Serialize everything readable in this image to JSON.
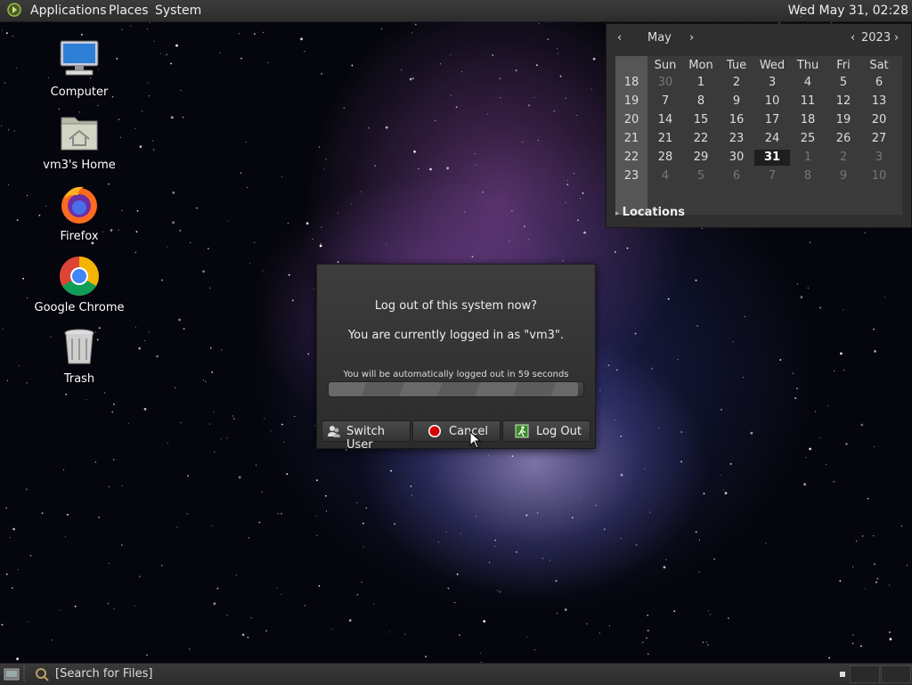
{
  "top_panel": {
    "menus": [
      "Applications",
      "Places",
      "System"
    ],
    "clock": "Wed May 31, 02:28"
  },
  "desktop_icons": [
    {
      "label": "Computer",
      "icon": "computer-icon"
    },
    {
      "label": "vm3's Home",
      "icon": "home-folder-icon"
    },
    {
      "label": "Firefox",
      "icon": "firefox-icon"
    },
    {
      "label": "Google Chrome",
      "icon": "chrome-icon"
    },
    {
      "label": "Trash",
      "icon": "trash-icon"
    }
  ],
  "calendar": {
    "month": "May",
    "year": "2023",
    "day_names": [
      "Sun",
      "Mon",
      "Tue",
      "Wed",
      "Thu",
      "Fri",
      "Sat"
    ],
    "weeks": [
      {
        "week": "18",
        "days": [
          "30",
          "1",
          "2",
          "3",
          "4",
          "5",
          "6"
        ]
      },
      {
        "week": "19",
        "days": [
          "7",
          "8",
          "9",
          "10",
          "11",
          "12",
          "13"
        ]
      },
      {
        "week": "20",
        "days": [
          "14",
          "15",
          "16",
          "17",
          "18",
          "19",
          "20"
        ]
      },
      {
        "week": "21",
        "days": [
          "21",
          "22",
          "23",
          "24",
          "25",
          "26",
          "27"
        ]
      },
      {
        "week": "22",
        "days": [
          "28",
          "29",
          "30",
          "31",
          "1",
          "2",
          "3"
        ]
      },
      {
        "week": "23",
        "days": [
          "4",
          "5",
          "6",
          "7",
          "8",
          "9",
          "10"
        ]
      }
    ],
    "selected_day": "31",
    "locations_label": "Locations"
  },
  "logout_dialog": {
    "question": "Log out of this system now?",
    "logged_in_as": "You are currently logged in as \"vm3\".",
    "auto_logout": "You will be automatically logged out in 59 seconds",
    "progress": 0.98,
    "buttons": {
      "switch_user": "Switch User",
      "cancel": "Cancel",
      "log_out": "Log Out"
    }
  },
  "bottom_panel": {
    "search_label": "[Search for Files]"
  },
  "colors": {
    "panel": "#2f2f2f",
    "cancel_icon": "#d40000",
    "logout_icon": "#3a8a2a"
  }
}
